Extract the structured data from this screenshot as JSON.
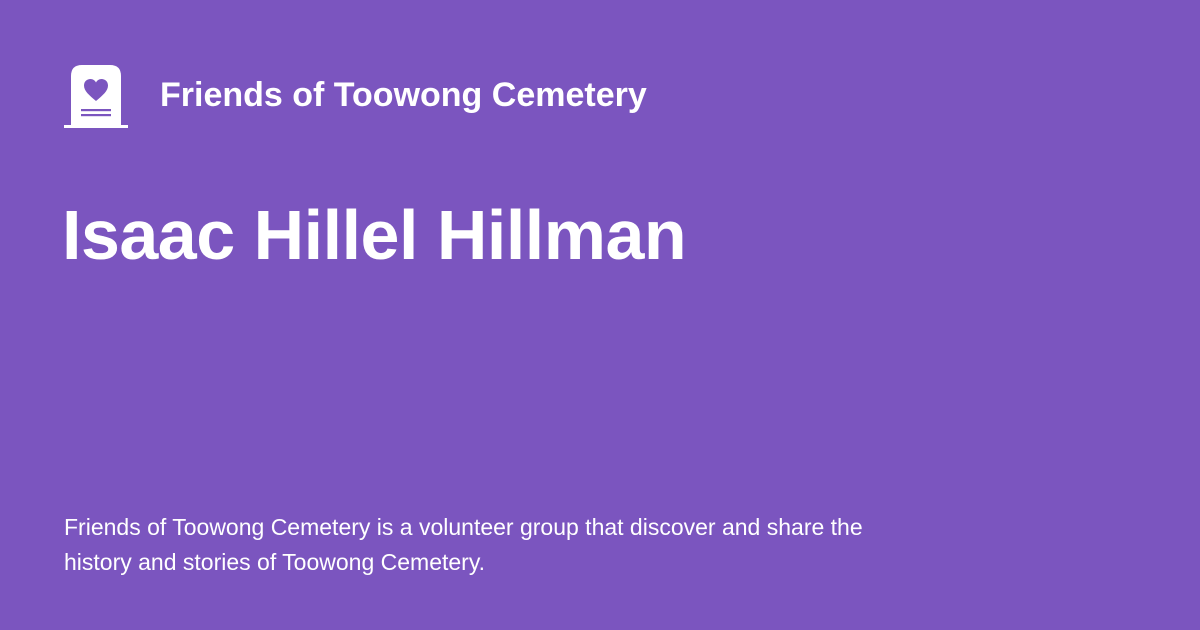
{
  "brand": {
    "name": "Friends of Toowong Cemetery",
    "icon": "headstone-heart-icon"
  },
  "page": {
    "title": "Isaac Hillel Hillman"
  },
  "description": "Friends of Toowong Cemetery is a volunteer group that discover and share the history and stories of Toowong Cemetery.",
  "colors": {
    "background": "#7b55bf",
    "text": "#ffffff"
  }
}
